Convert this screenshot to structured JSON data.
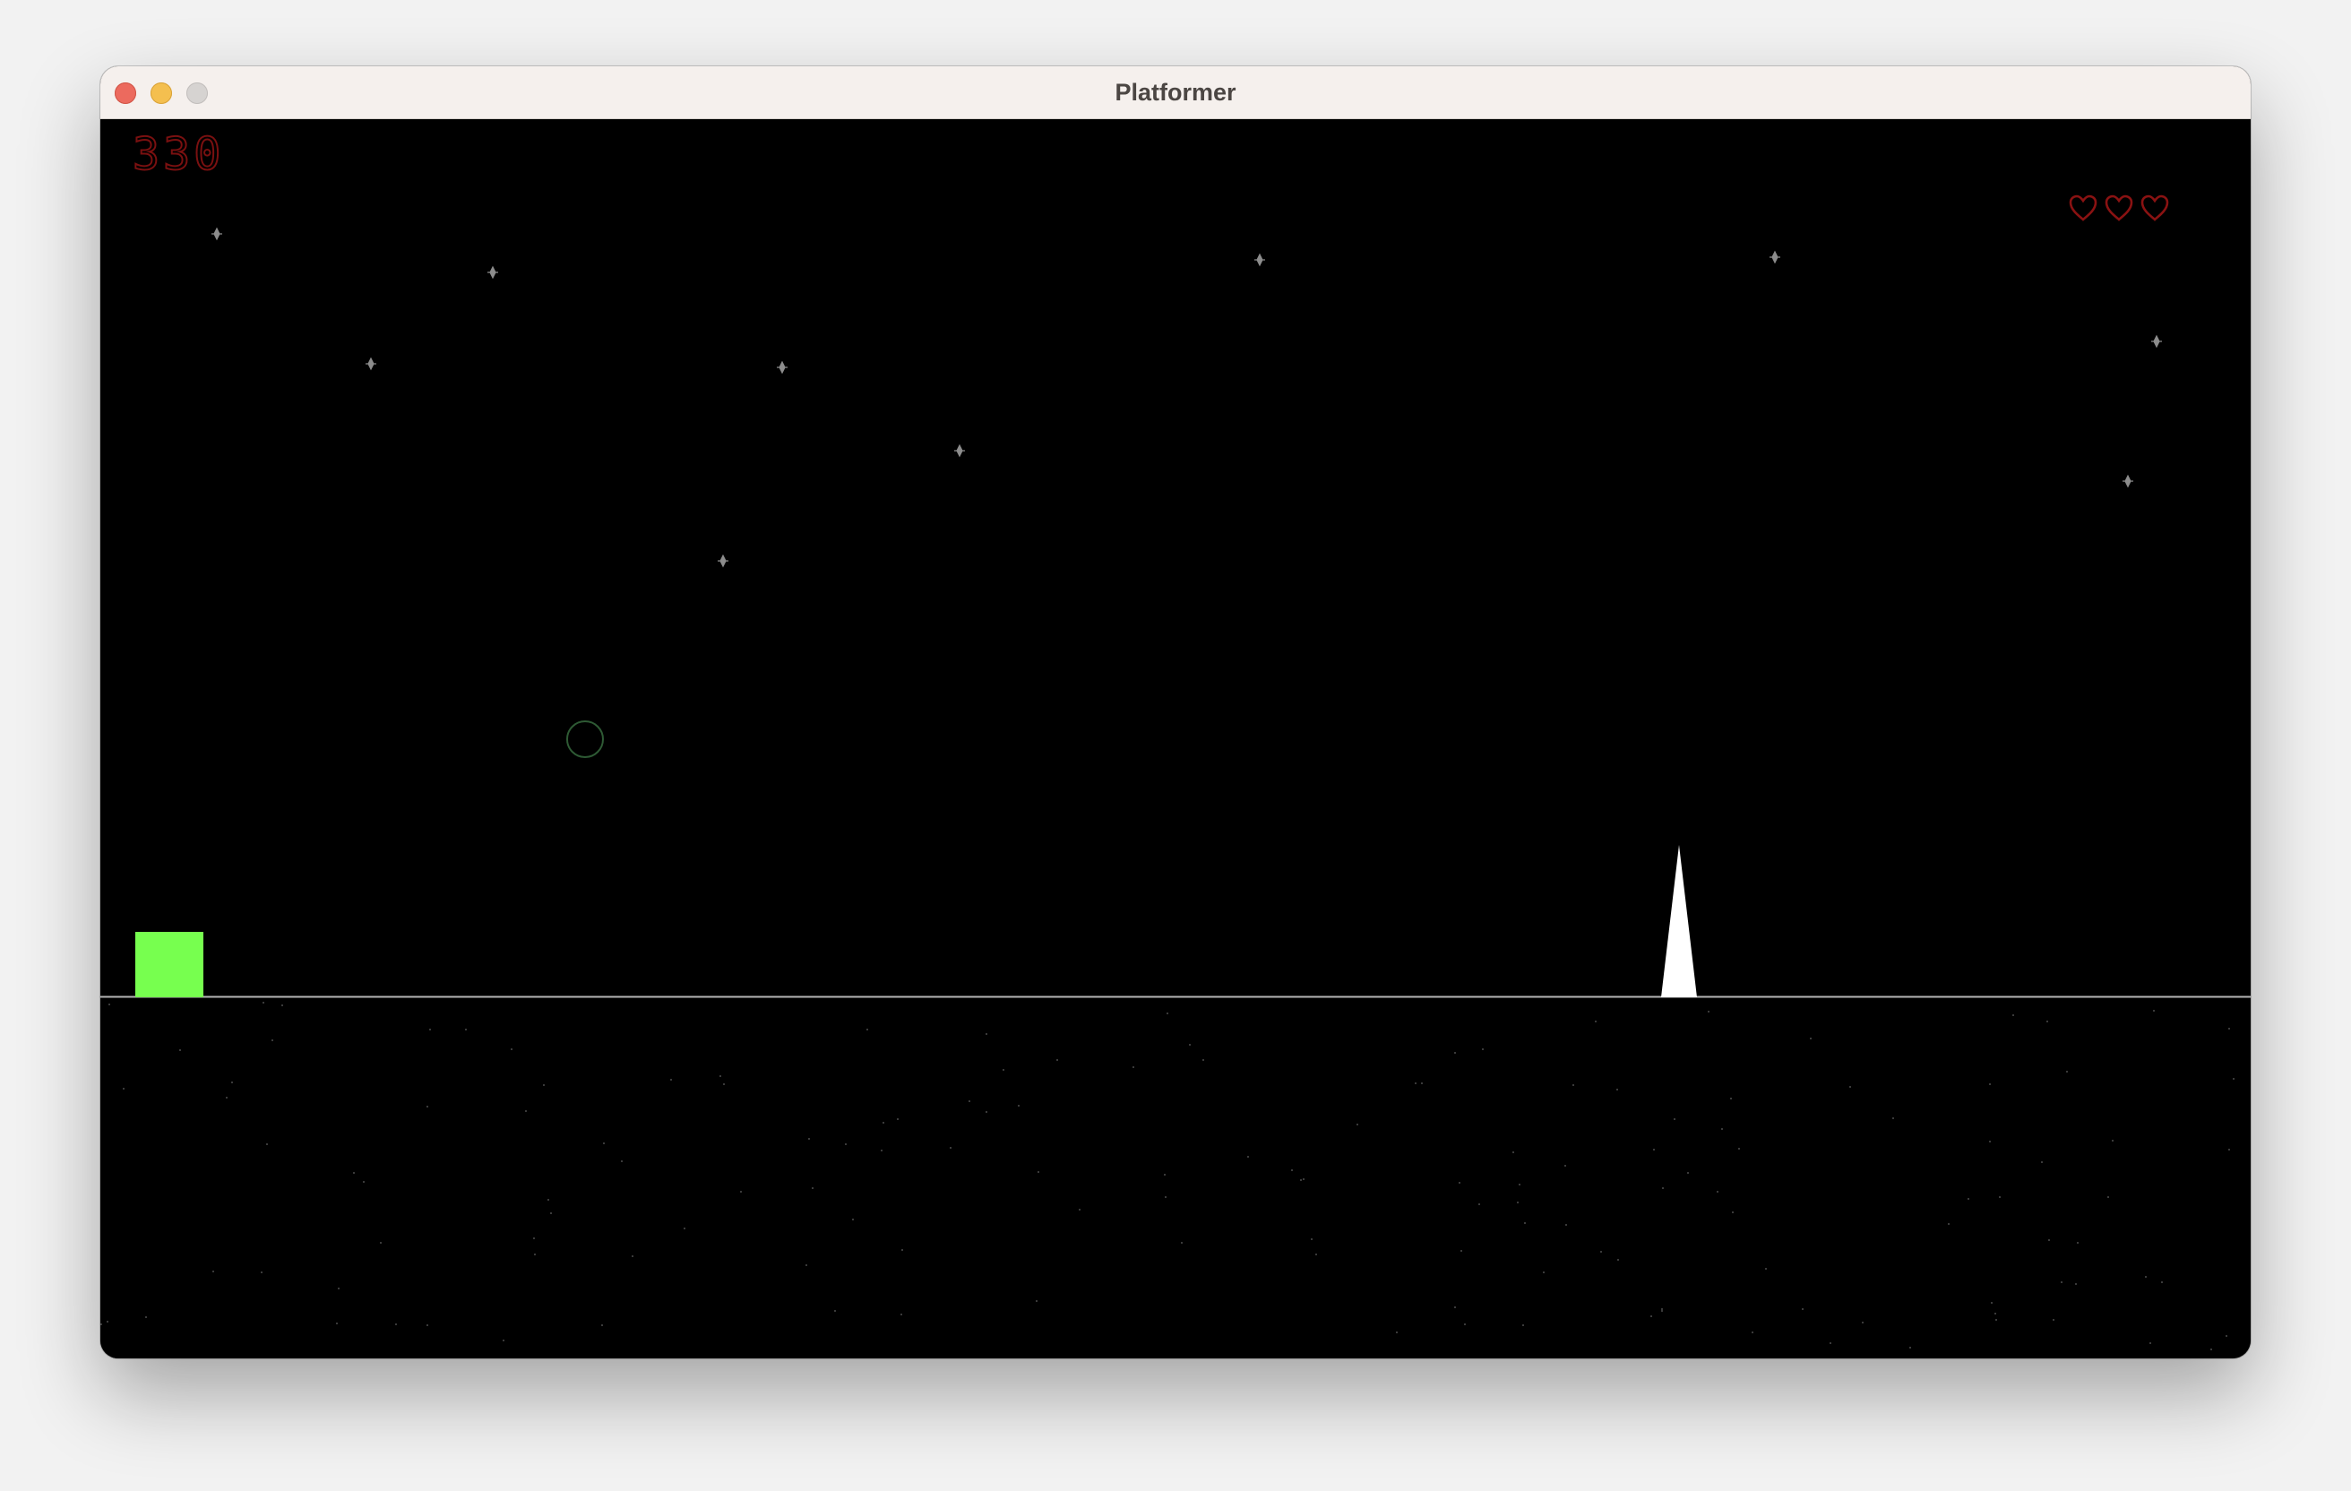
{
  "window": {
    "title": "Platformer",
    "controls": [
      "close",
      "minimize",
      "zoom"
    ]
  },
  "hud": {
    "score": "330",
    "lives": 3,
    "score_color": "#7a1010",
    "heart_color": "#8a1212"
  },
  "scene": {
    "background_color": "#000000",
    "player_color": "#77ff4f",
    "spike_color": "#ffffff",
    "ground_line_color": "#b5b5b5",
    "sparkle_color": "#8c8c8c",
    "ring_color": "#2e5a34"
  }
}
